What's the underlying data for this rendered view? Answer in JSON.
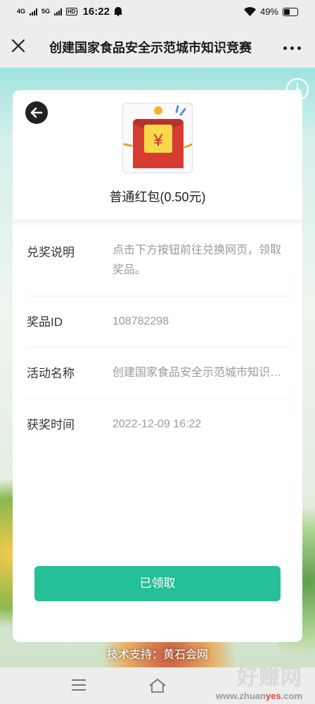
{
  "status_bar": {
    "network_1": "4G",
    "network_2": "5G",
    "hd": "HD",
    "time": "16:22",
    "battery_percent": "49%",
    "battery_level": 0.49
  },
  "nav": {
    "title": "创建国家食品安全示范城市知识竞赛",
    "close_icon": "close-icon",
    "more_icon": "more-icon"
  },
  "prize": {
    "icon": "red-envelope-icon",
    "yen": "¥",
    "title": "普通红包(0.50元)"
  },
  "info": [
    {
      "label": "兑奖说明",
      "value": "点击下方按钮前往兑换网页，领取奖品。"
    },
    {
      "label": "奖品ID",
      "value": "108782298"
    },
    {
      "label": "活动名称",
      "value": "创建国家食品安全示范城市知识竞赛"
    },
    {
      "label": "获奖时间",
      "value": "2022-12-09 16:22"
    }
  ],
  "button": {
    "label": "已领取"
  },
  "footer": {
    "text": "技术支持：黄石会网"
  },
  "watermark": {
    "big": "好赚网",
    "url_pre": "www.zhuan",
    "url_hl": "yes",
    "url_post": ".com"
  },
  "colors": {
    "accent": "#25bf98",
    "envelope": "#cc3a2e",
    "coin": "#f7d84a"
  }
}
